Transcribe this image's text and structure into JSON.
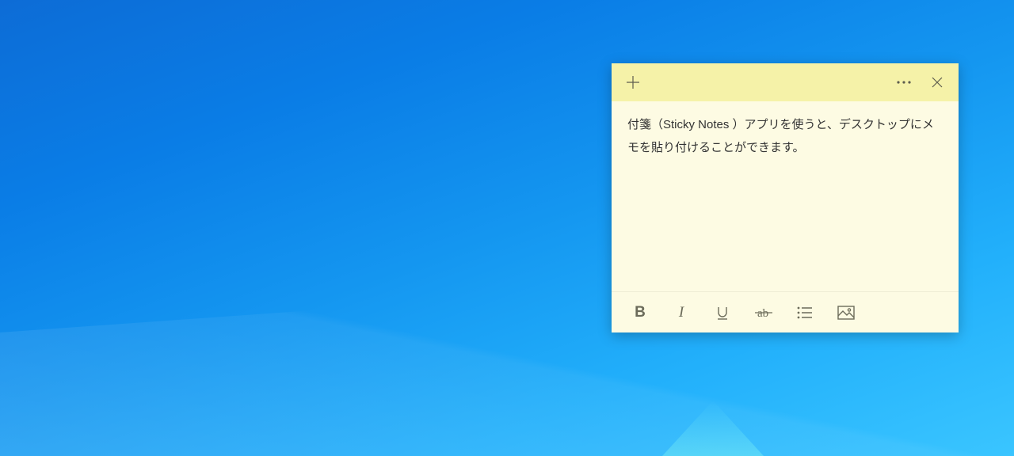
{
  "note": {
    "content": "付箋（Sticky Notes ）アプリを使うと、デスクトップにメモを貼り付けることができます。",
    "header": {
      "add": "+",
      "menu": "⋯",
      "close": "×"
    },
    "toolbar": {
      "bold": "B",
      "italic": "I",
      "underline": "U",
      "strikethrough": "ab",
      "list": "list",
      "image": "image"
    },
    "colors": {
      "header_bg": "#f5f2a8",
      "body_bg": "#fdfbe3"
    }
  }
}
